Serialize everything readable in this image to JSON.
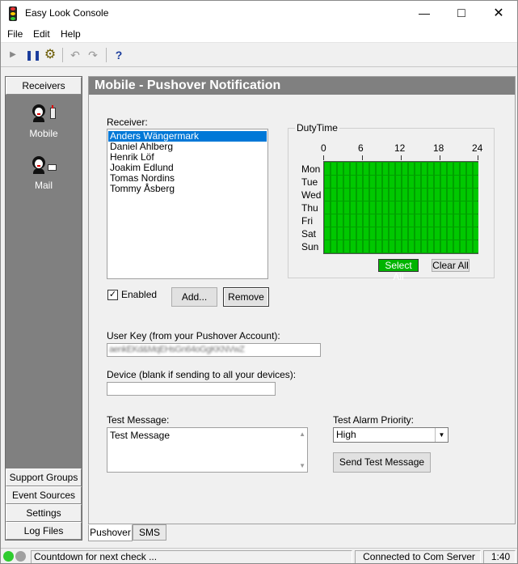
{
  "window": {
    "title": "Easy Look Console"
  },
  "menu": {
    "file": "File",
    "edit": "Edit",
    "help": "Help"
  },
  "toolbar": {
    "help_glyph": "?"
  },
  "sidebar": {
    "header": "Receivers",
    "items": [
      {
        "label": "Mobile",
        "icon": "mobile-person-icon"
      },
      {
        "label": "Mail",
        "icon": "mail-person-icon"
      }
    ],
    "buttons": [
      "Support Groups",
      "Event Sources",
      "Settings",
      "Log Files"
    ]
  },
  "panel": {
    "title": "Mobile - Pushover Notification",
    "receiver_label": "Receiver:",
    "receivers": [
      "Anders Wängermark",
      "Daniel Ahlberg",
      "Henrik Löf",
      "Joakim Edlund",
      "Tomas Nordins",
      "Tommy Åsberg"
    ],
    "selected_receiver": "Anders Wängermark",
    "enabled_label": "Enabled",
    "enabled": true,
    "add_button": "Add...",
    "remove_button": "Remove",
    "user_key_label": "User Key (from your Pushover Account):",
    "user_key_value": "aenkEKd&MqEHsGn64oGgKKNVwZ",
    "device_label": "Device (blank if sending to all your devices):",
    "device_value": "",
    "test_message_label": "Test Message:",
    "test_message_value": "Test Message",
    "priority_label": "Test Alarm Priority:",
    "priority_value": "High",
    "send_button": "Send Test Message"
  },
  "duty_time": {
    "title": "DutyTime",
    "days": [
      "Mon",
      "Tue",
      "Wed",
      "Thu",
      "Fri",
      "Sat",
      "Sun"
    ],
    "hour_labels": [
      "0",
      "6",
      "12",
      "18",
      "24"
    ],
    "all_hours_active": true,
    "active_color": "#00c800",
    "select_all": "Select All",
    "clear_all": "Clear All"
  },
  "tabs": [
    "Pushover",
    "SMS"
  ],
  "status": {
    "countdown": "Countdown for next check ...",
    "connection": "Connected to Com Server",
    "time": "1:40",
    "led_green": "#2ecc2e",
    "led_grey": "#a0a0a0"
  }
}
